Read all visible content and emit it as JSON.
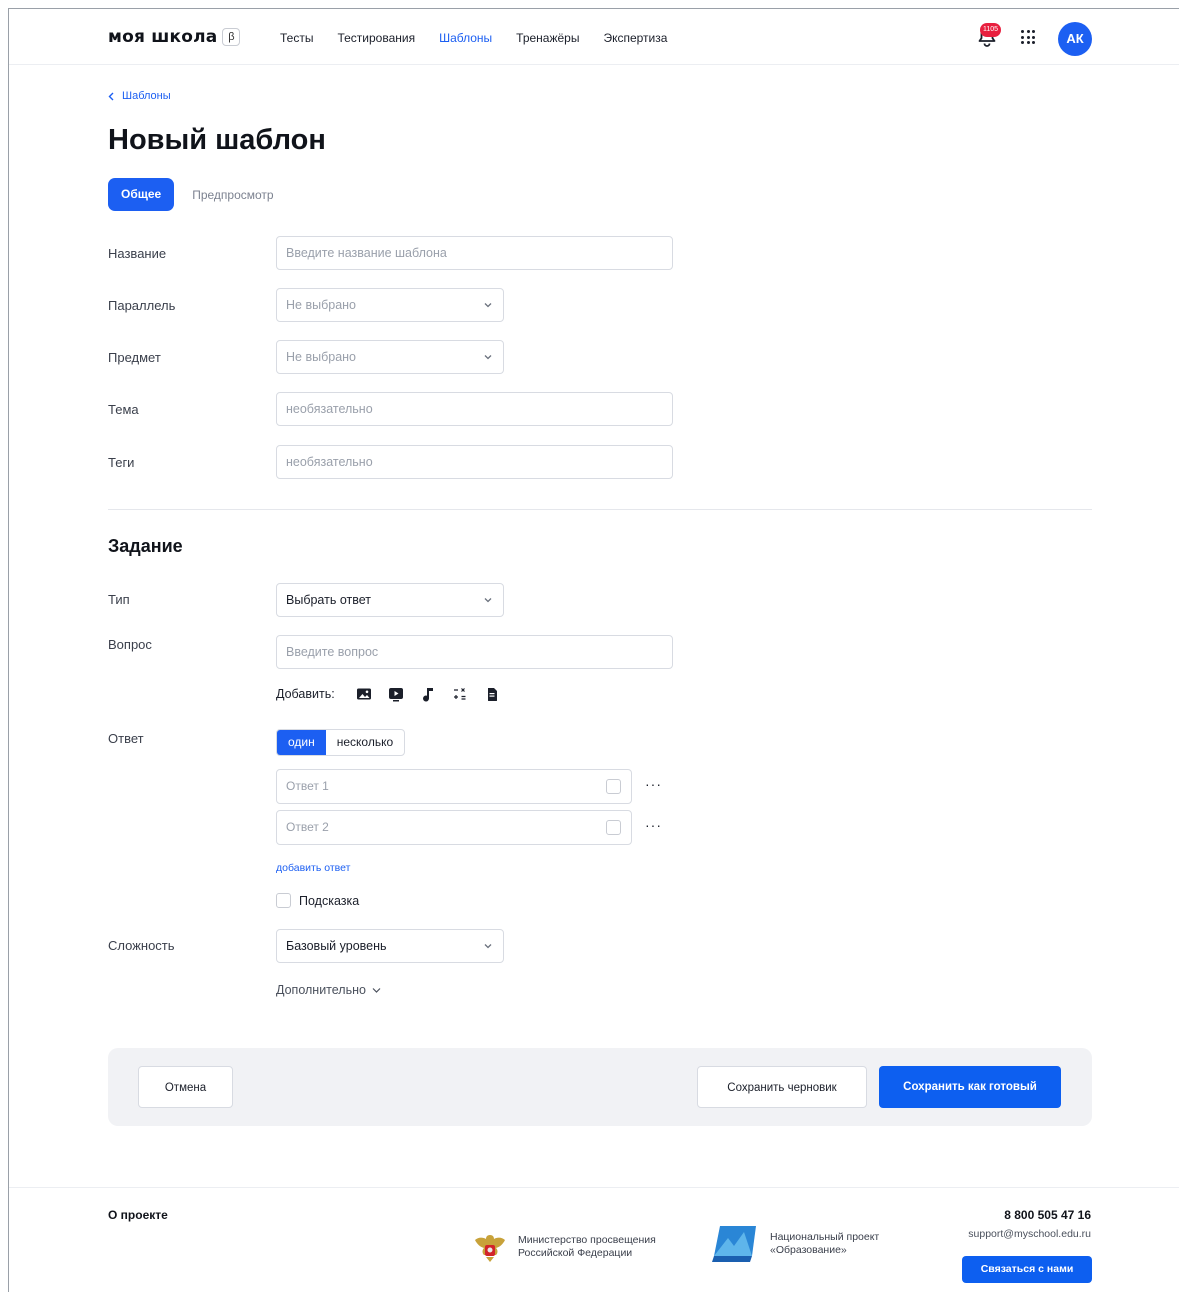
{
  "header": {
    "logo": "моя школа",
    "beta": "β",
    "nav": [
      "Тесты",
      "Тестирования",
      "Шаблоны",
      "Тренажёры",
      "Экспертиза"
    ],
    "active_nav": "Шаблоны",
    "notifications_count": "1105",
    "avatar_initials": "АК"
  },
  "breadcrumb": {
    "label": "Шаблоны"
  },
  "page_title": "Новый шаблон",
  "tabs": {
    "active": "Общее",
    "inactive": "Предпросмотр"
  },
  "general": {
    "name": {
      "label": "Название",
      "placeholder": "Введите название шаблона"
    },
    "parallel": {
      "label": "Параллель",
      "value": "Не выбрано"
    },
    "subject": {
      "label": "Предмет",
      "value": "Не выбрано"
    },
    "topic": {
      "label": "Тема",
      "placeholder": "необязательно"
    },
    "tags": {
      "label": "Теги",
      "placeholder": "необязательно"
    }
  },
  "task": {
    "section_title": "Задание",
    "type": {
      "label": "Тип",
      "value": "Выбрать ответ"
    },
    "question": {
      "label": "Вопрос",
      "placeholder": "Введите вопрос"
    },
    "add_label": "Добавить:",
    "add_icons": [
      "image-icon",
      "video-icon",
      "audio-icon",
      "formula-icon",
      "file-icon"
    ],
    "answer": {
      "label": "Ответ",
      "mode_one": "один",
      "mode_many": "несколько",
      "options": [
        "Ответ 1",
        "Ответ 2"
      ],
      "more": "···",
      "add_answer": "добавить ответ"
    },
    "hint": "Подсказка",
    "difficulty": {
      "label": "Сложность",
      "value": "Базовый уровень"
    },
    "additional": "Дополнительно"
  },
  "actions": {
    "cancel": "Отмена",
    "save_draft": "Сохранить черновик",
    "save_ready": "Сохранить как готовый"
  },
  "footer": {
    "about": "О проекте",
    "ministry_line1": "Министерство просвещения",
    "ministry_line2": "Российской Федерации",
    "project_line1": "Национальный проект",
    "project_line2": "«Образование»",
    "phone": "8 800 505 47 16",
    "email": "support@myschool.edu.ru",
    "contact_button": "Связаться с нами"
  },
  "colors": {
    "accent": "#1c5ff2",
    "badge": "#e8203f",
    "panel": "#f1f2f5"
  }
}
